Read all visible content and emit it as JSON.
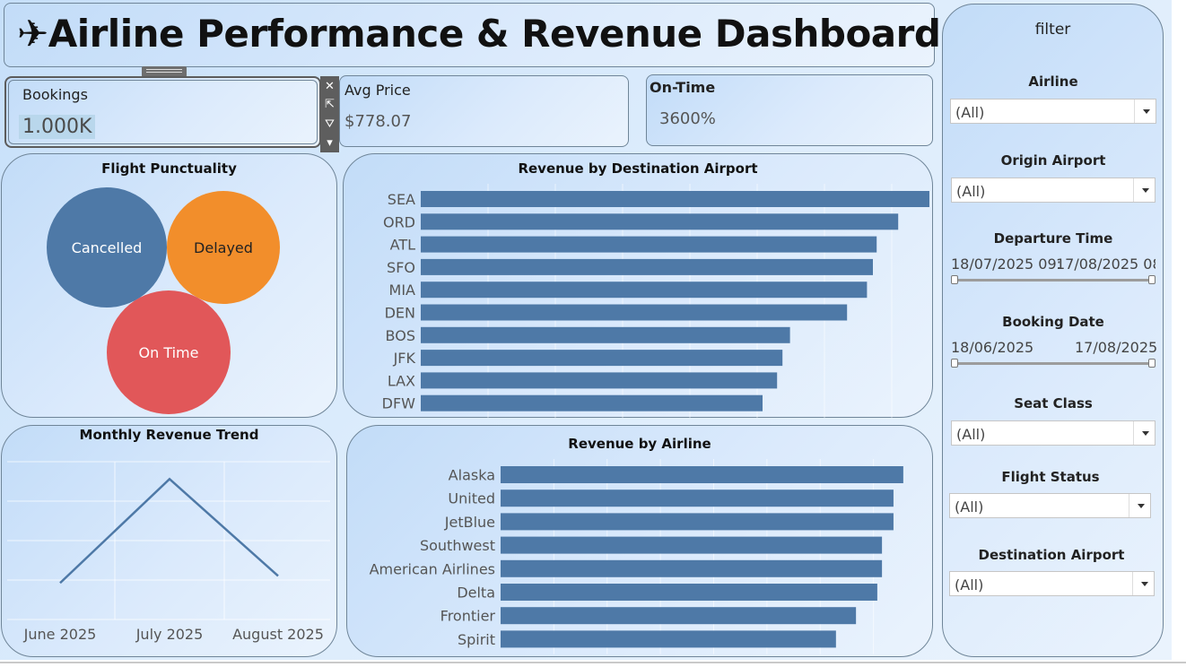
{
  "title": "✈Airline Performance & Revenue Dashboard✈",
  "kpis": {
    "bookings": {
      "label": "Bookings",
      "value": "1.000K"
    },
    "avg_price": {
      "label": "Avg Price",
      "value": "$778.07"
    },
    "on_time": {
      "label": "On-Time",
      "value": "3600%"
    }
  },
  "toolbar": {
    "close": "✕",
    "popout": "⇱",
    "filter": "⛛",
    "more": "▾"
  },
  "punctuality": {
    "title": "Flight Punctuality",
    "bubbles": [
      {
        "label": "Cancelled",
        "color": "#4e79a7",
        "text_color": "#ffffff"
      },
      {
        "label": "Delayed",
        "color": "#f28e2b",
        "text_color": "#222222"
      },
      {
        "label": "On Time",
        "color": "#e15759",
        "text_color": "#ffffff"
      }
    ]
  },
  "colors": {
    "bar": "#4e79a7",
    "line": "#4e79a7"
  },
  "chart_data": [
    {
      "type": "bar",
      "title": "Revenue by Destination Airport",
      "orientation": "horizontal",
      "categories": [
        "SEA",
        "ORD",
        "ATL",
        "SFO",
        "MIA",
        "DEN",
        "BOS",
        "JFK",
        "LAX",
        "DFW"
      ],
      "values": [
        94.5,
        88.7,
        84.7,
        84.0,
        82.9,
        79.2,
        68.6,
        67.2,
        66.2,
        63.5
      ],
      "xlim": [
        0,
        100
      ],
      "grid": true
    },
    {
      "type": "line",
      "title": "Monthly Revenue Trend",
      "x": [
        "June 2025",
        "July 2025",
        "August 2025"
      ],
      "values": [
        26,
        100,
        31
      ],
      "ylim": [
        0,
        120
      ],
      "grid": true
    },
    {
      "type": "bar",
      "title": "Revenue by Airline",
      "orientation": "horizontal",
      "categories": [
        "Alaska",
        "United",
        "JetBlue",
        "Southwest",
        "American Airlines",
        "Delta",
        "Frontier",
        "Spirit"
      ],
      "values": [
        94.5,
        92.2,
        92.2,
        89.5,
        89.5,
        88.4,
        83.4,
        78.7
      ],
      "xlim": [
        0,
        100
      ],
      "grid": true
    }
  ],
  "filters": {
    "heading": "filter",
    "airline": {
      "label": "Airline",
      "value": "(All)"
    },
    "origin": {
      "label": "Origin Airport",
      "value": "(All)"
    },
    "departure": {
      "label": "Departure Time",
      "start": "18/07/2025 09:",
      "end": "17/08/2025 08:"
    },
    "booking": {
      "label": "Booking Date",
      "start": "18/06/2025",
      "end": "17/08/2025"
    },
    "seat": {
      "label": "Seat Class",
      "value": "(All)"
    },
    "status": {
      "label": "Flight Status",
      "value": "(All)"
    },
    "destination": {
      "label": "Destination Airport",
      "value": "(All)"
    }
  }
}
